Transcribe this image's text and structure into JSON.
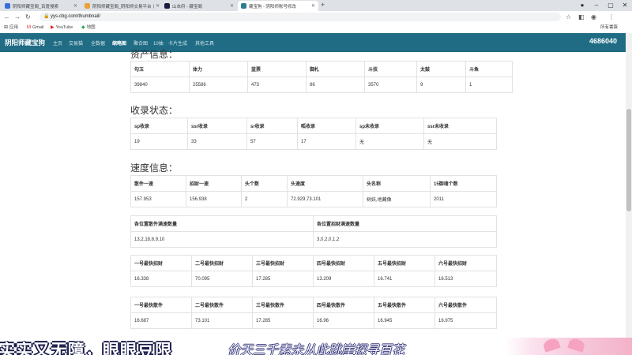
{
  "browser": {
    "tabs": [
      {
        "title": "阴阳师藏宝阁_百度搜索",
        "color": "#3a6fd8"
      },
      {
        "title": "阴阳师藏宝阁_阴阳师交易平台丨",
        "color": "#e9a23b"
      },
      {
        "title": "山本府 - 藏宝阁",
        "color": "#1a1a40"
      },
      {
        "title": "藏宝狗 - 阴阳师账号修改",
        "color": "#2e7c91"
      }
    ],
    "url": "yys-cbg.com/thumbnail/",
    "bookmarks": [
      "应用",
      "Gmail",
      "YouTube",
      "地图"
    ],
    "extension_label": "所有書簽"
  },
  "site": {
    "brand": "阴阳师藏宝狗",
    "nav": [
      "主页",
      "交易猫",
      "全数据",
      "缩略图",
      "聚合图",
      "10抽",
      "卡片生成",
      "其他工具"
    ],
    "active_nav_index": 3,
    "counter": "4686040"
  },
  "sections": {
    "assets": {
      "title": "资产信息：",
      "headers": [
        "勾玉",
        "体力",
        "蓝票",
        "御札",
        "斗技",
        "太鼓",
        "斗鱼"
      ],
      "values": [
        "39840",
        "25586",
        "473",
        "86",
        "3570",
        "9",
        "1"
      ]
    },
    "collection": {
      "title": "收录状态：",
      "headers": [
        "sp收录",
        "ssr收录",
        "sr收录",
        "呱收录",
        "sp未收录",
        "ssr未收录"
      ],
      "values": [
        "19",
        "33",
        "57",
        "17",
        "无",
        "无"
      ]
    },
    "speed": {
      "title": "速度信息：",
      "table1": {
        "headers": [
          "散件一速",
          "招财一速",
          "头个数",
          "头速度",
          "头名称",
          "15御魂个数"
        ],
        "values": [
          "157.953",
          "156.938",
          "2",
          "72.929,73.101",
          "树妖,地藏像",
          "2011"
        ]
      },
      "table2": {
        "headers": [
          "各位置散件满速数量",
          "各位置招财满速数量"
        ],
        "values": [
          "13,2,18,8,9,10",
          "3,0,2,0,1,2"
        ]
      },
      "table3": {
        "headers": [
          "一号最快招财",
          "二号最快招财",
          "三号最快招财",
          "四号最快招财",
          "五号最快招财",
          "六号最快招财"
        ],
        "values": [
          "16.338",
          "70.095",
          "17.285",
          "13.209",
          "16.741",
          "16.513"
        ]
      },
      "table4": {
        "headers": [
          "一号最快散件",
          "二号最快散件",
          "三号最快散件",
          "四号最快散件",
          "五号最快散件",
          "六号最快散件"
        ],
        "values": [
          "16.687",
          "73.101",
          "17.285",
          "16.96",
          "16.945",
          "16.975"
        ]
      }
    }
  },
  "overlay": {
    "subtitle_main": "实实又无障，眼眼豆限",
    "subtitle_second": "价天三千素未从此跳崖探寻百花"
  }
}
